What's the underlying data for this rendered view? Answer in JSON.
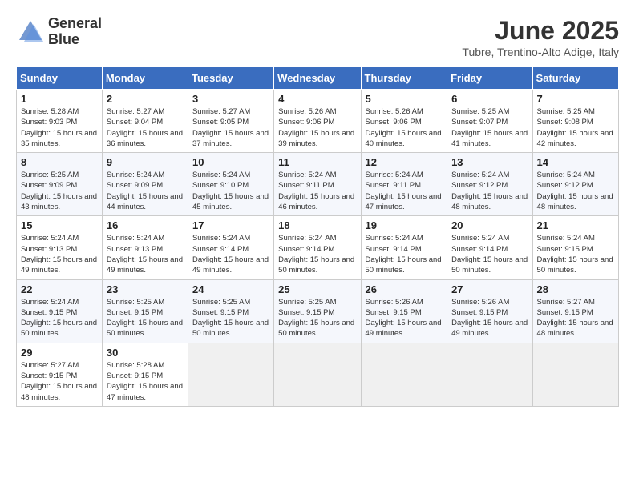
{
  "app": {
    "name": "GeneralBlue",
    "logo_text_line1": "General",
    "logo_text_line2": "Blue"
  },
  "calendar": {
    "title": "June 2025",
    "location": "Tubre, Trentino-Alto Adige, Italy",
    "headers": [
      "Sunday",
      "Monday",
      "Tuesday",
      "Wednesday",
      "Thursday",
      "Friday",
      "Saturday"
    ],
    "weeks": [
      [
        {
          "day": "1",
          "sunrise": "5:28 AM",
          "sunset": "9:03 PM",
          "daylight": "15 hours and 35 minutes."
        },
        {
          "day": "2",
          "sunrise": "5:27 AM",
          "sunset": "9:04 PM",
          "daylight": "15 hours and 36 minutes."
        },
        {
          "day": "3",
          "sunrise": "5:27 AM",
          "sunset": "9:05 PM",
          "daylight": "15 hours and 37 minutes."
        },
        {
          "day": "4",
          "sunrise": "5:26 AM",
          "sunset": "9:06 PM",
          "daylight": "15 hours and 39 minutes."
        },
        {
          "day": "5",
          "sunrise": "5:26 AM",
          "sunset": "9:06 PM",
          "daylight": "15 hours and 40 minutes."
        },
        {
          "day": "6",
          "sunrise": "5:25 AM",
          "sunset": "9:07 PM",
          "daylight": "15 hours and 41 minutes."
        },
        {
          "day": "7",
          "sunrise": "5:25 AM",
          "sunset": "9:08 PM",
          "daylight": "15 hours and 42 minutes."
        }
      ],
      [
        {
          "day": "8",
          "sunrise": "5:25 AM",
          "sunset": "9:09 PM",
          "daylight": "15 hours and 43 minutes."
        },
        {
          "day": "9",
          "sunrise": "5:24 AM",
          "sunset": "9:09 PM",
          "daylight": "15 hours and 44 minutes."
        },
        {
          "day": "10",
          "sunrise": "5:24 AM",
          "sunset": "9:10 PM",
          "daylight": "15 hours and 45 minutes."
        },
        {
          "day": "11",
          "sunrise": "5:24 AM",
          "sunset": "9:11 PM",
          "daylight": "15 hours and 46 minutes."
        },
        {
          "day": "12",
          "sunrise": "5:24 AM",
          "sunset": "9:11 PM",
          "daylight": "15 hours and 47 minutes."
        },
        {
          "day": "13",
          "sunrise": "5:24 AM",
          "sunset": "9:12 PM",
          "daylight": "15 hours and 48 minutes."
        },
        {
          "day": "14",
          "sunrise": "5:24 AM",
          "sunset": "9:12 PM",
          "daylight": "15 hours and 48 minutes."
        }
      ],
      [
        {
          "day": "15",
          "sunrise": "5:24 AM",
          "sunset": "9:13 PM",
          "daylight": "15 hours and 49 minutes."
        },
        {
          "day": "16",
          "sunrise": "5:24 AM",
          "sunset": "9:13 PM",
          "daylight": "15 hours and 49 minutes."
        },
        {
          "day": "17",
          "sunrise": "5:24 AM",
          "sunset": "9:14 PM",
          "daylight": "15 hours and 49 minutes."
        },
        {
          "day": "18",
          "sunrise": "5:24 AM",
          "sunset": "9:14 PM",
          "daylight": "15 hours and 50 minutes."
        },
        {
          "day": "19",
          "sunrise": "5:24 AM",
          "sunset": "9:14 PM",
          "daylight": "15 hours and 50 minutes."
        },
        {
          "day": "20",
          "sunrise": "5:24 AM",
          "sunset": "9:14 PM",
          "daylight": "15 hours and 50 minutes."
        },
        {
          "day": "21",
          "sunrise": "5:24 AM",
          "sunset": "9:15 PM",
          "daylight": "15 hours and 50 minutes."
        }
      ],
      [
        {
          "day": "22",
          "sunrise": "5:24 AM",
          "sunset": "9:15 PM",
          "daylight": "15 hours and 50 minutes."
        },
        {
          "day": "23",
          "sunrise": "5:25 AM",
          "sunset": "9:15 PM",
          "daylight": "15 hours and 50 minutes."
        },
        {
          "day": "24",
          "sunrise": "5:25 AM",
          "sunset": "9:15 PM",
          "daylight": "15 hours and 50 minutes."
        },
        {
          "day": "25",
          "sunrise": "5:25 AM",
          "sunset": "9:15 PM",
          "daylight": "15 hours and 50 minutes."
        },
        {
          "day": "26",
          "sunrise": "5:26 AM",
          "sunset": "9:15 PM",
          "daylight": "15 hours and 49 minutes."
        },
        {
          "day": "27",
          "sunrise": "5:26 AM",
          "sunset": "9:15 PM",
          "daylight": "15 hours and 49 minutes."
        },
        {
          "day": "28",
          "sunrise": "5:27 AM",
          "sunset": "9:15 PM",
          "daylight": "15 hours and 48 minutes."
        }
      ],
      [
        {
          "day": "29",
          "sunrise": "5:27 AM",
          "sunset": "9:15 PM",
          "daylight": "15 hours and 48 minutes."
        },
        {
          "day": "30",
          "sunrise": "5:28 AM",
          "sunset": "9:15 PM",
          "daylight": "15 hours and 47 minutes."
        },
        null,
        null,
        null,
        null,
        null
      ]
    ]
  }
}
